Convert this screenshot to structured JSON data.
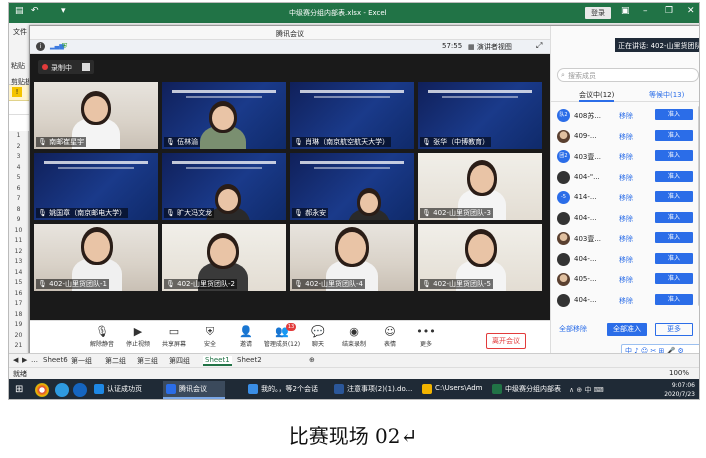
{
  "excel": {
    "window_title": "中级赛分组内部表.xlsx - Excel",
    "login": "登录",
    "ribbon_tab": "文件",
    "side_labels": [
      "粘贴",
      "剪贴板"
    ],
    "row_numbers": [
      "1",
      "2",
      "3",
      "4",
      "5",
      "6",
      "7",
      "8",
      "9",
      "10",
      "11",
      "12",
      "13",
      "14",
      "15",
      "16",
      "17",
      "18",
      "19",
      "20",
      "21"
    ],
    "sheets": [
      "Sheet6",
      "第一组",
      "第二组",
      "第三组",
      "第四组",
      "Sheet1",
      "Sheet2"
    ],
    "active_sheet": "Sheet1",
    "status_ready": "就绪",
    "zoom": "100%"
  },
  "meeting": {
    "title": "腾讯会议",
    "time": "57:55",
    "view_button": "演讲者视图",
    "recording": "录制中",
    "tiles": [
      {
        "name": "南邮崔星宇"
      },
      {
        "name": "伍林渝"
      },
      {
        "name": "肖琳（南京航空航天大学）"
      },
      {
        "name": "张华（中博教育）"
      },
      {
        "name": "姚国章（南京邮电大学）"
      },
      {
        "name": "旷大冯文龙"
      },
      {
        "name": "郝永安"
      },
      {
        "name": "402-山里货团队-3"
      },
      {
        "name": "402-山里货团队-1"
      },
      {
        "name": "402-山里货团队-2"
      },
      {
        "name": "402-山里货团队-4"
      },
      {
        "name": "402-山里货团队-5"
      }
    ],
    "toolbar": [
      {
        "icon": "mic-icon",
        "glyph": "🎙",
        "label": "解除静音"
      },
      {
        "icon": "camera-icon",
        "glyph": "▶",
        "label": "停止视频"
      },
      {
        "icon": "screen-share-icon",
        "glyph": "▭",
        "label": "共享屏幕"
      },
      {
        "icon": "shield-icon",
        "glyph": "⛨",
        "label": "安全"
      },
      {
        "icon": "invite-icon",
        "glyph": "👤",
        "label": "邀请"
      },
      {
        "icon": "members-icon",
        "glyph": "👥",
        "label": "管理成员(12)",
        "badge": "13"
      },
      {
        "icon": "chat-icon",
        "glyph": "💬",
        "label": "聊天"
      },
      {
        "icon": "record-icon",
        "glyph": "◉",
        "label": "结束录制"
      },
      {
        "icon": "emoji-icon",
        "glyph": "☺",
        "label": "表情"
      },
      {
        "icon": "more-icon",
        "glyph": "•••",
        "label": "更多"
      }
    ],
    "leave_button": "离开会议"
  },
  "members": {
    "speaking": "正在讲话: 402-山里货团队-5...",
    "search_placeholder": "搜索成员",
    "tab_in_meeting": "会议中(12)",
    "tab_waiting": "等候中(13)",
    "list": [
      {
        "avatar": "队2",
        "name": "408苏...",
        "remove": "移除",
        "admit": "准入",
        "style": "blue"
      },
      {
        "avatar": "",
        "name": "409-...",
        "remove": "移除",
        "admit": "准入",
        "style": "photo"
      },
      {
        "avatar": "团2",
        "name": "403壹...",
        "remove": "移除",
        "admit": "准入",
        "style": "blue"
      },
      {
        "avatar": "",
        "name": "404-\"...",
        "remove": "移除",
        "admit": "准入",
        "style": "dark"
      },
      {
        "avatar": "-5",
        "name": "414-...",
        "remove": "移除",
        "admit": "准入",
        "style": "blue"
      },
      {
        "avatar": "",
        "name": "404-...",
        "remove": "移除",
        "admit": "准入",
        "style": "dark"
      },
      {
        "avatar": "",
        "name": "403壹...",
        "remove": "移除",
        "admit": "准入",
        "style": "photo"
      },
      {
        "avatar": "",
        "name": "404-...",
        "remove": "移除",
        "admit": "准入",
        "style": "dark"
      },
      {
        "avatar": "",
        "name": "405-...",
        "remove": "移除",
        "admit": "准入",
        "style": "photo"
      },
      {
        "avatar": "",
        "name": "404-...",
        "remove": "移除",
        "admit": "准入",
        "style": "dark"
      }
    ],
    "remove_all": "全部移除",
    "admit_all": "全部准入",
    "more": "更多",
    "ime_bar": "中 ♪ ☺ ✂ ⊞ 🎤 ⚙"
  },
  "taskbar": {
    "apps": [
      {
        "label": "认证成功页",
        "color": "#1e88e5"
      },
      {
        "label": "腾讯会议",
        "color": "#2b6de8",
        "active": true
      },
      {
        "label": "我的。，等2个会话",
        "color": "#3a8ee6"
      },
      {
        "label": "注意事项(2)(1).do...",
        "color": "#2b579a"
      },
      {
        "label": "C:\\Users\\Admini...",
        "color": "#f2b400"
      },
      {
        "label": "中级赛分组内部表...",
        "color": "#217346"
      }
    ],
    "tray": "∧ ⊕ 中 ⌨",
    "time": "9:07:06",
    "date": "2020/7/23"
  },
  "caption": "比赛现场 02↵"
}
